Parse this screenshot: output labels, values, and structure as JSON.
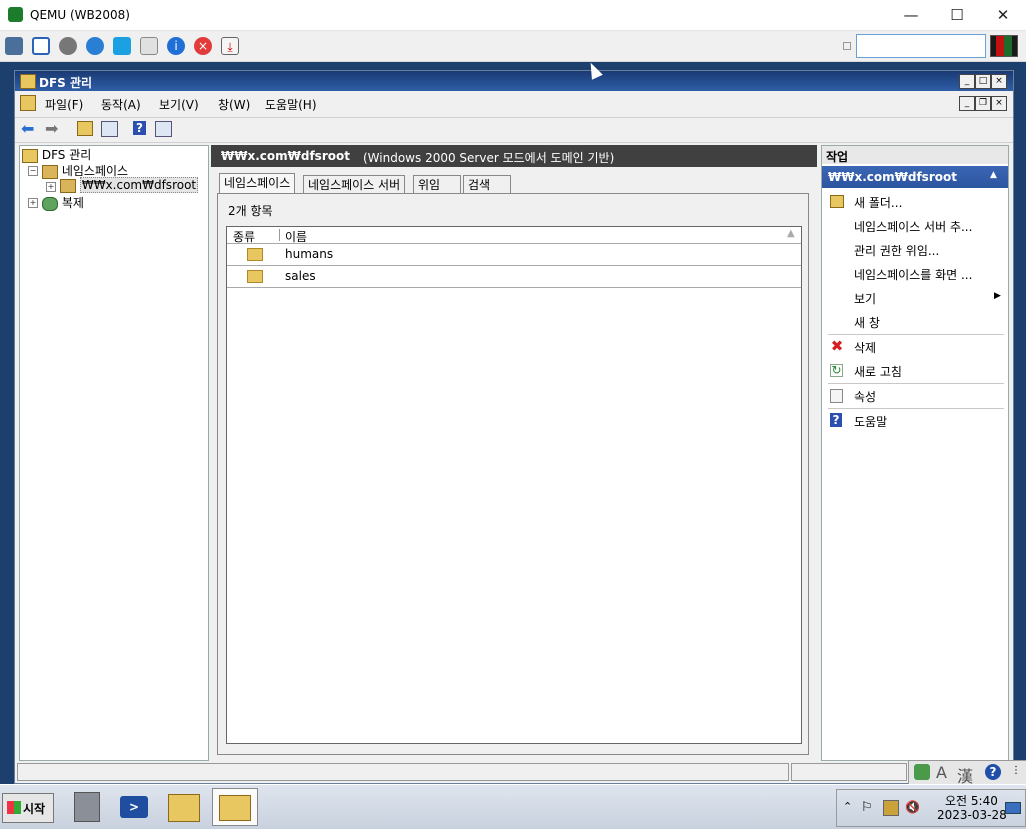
{
  "host": {
    "title": "QEMU (WB2008)",
    "min_icon": "—",
    "max_icon": "☐",
    "close_icon": "✕"
  },
  "mmc": {
    "title": "DFS 관리",
    "menu": [
      "파일(F)",
      "동작(A)",
      "보기(V)",
      "창(W)",
      "도움말(H)"
    ]
  },
  "tree": {
    "root": "DFS 관리",
    "namespaces": "네임스페이스",
    "selected": "₩₩x.com₩dfsroot",
    "replication": "복제"
  },
  "center": {
    "path": "₩₩x.com₩dfsroot",
    "description": "(Windows 2000 Server 모드에서 도메인 기반)",
    "tabs": [
      "네임스페이스",
      "네임스페이스 서버",
      "위임",
      "검색"
    ],
    "count": "2개 항목",
    "columns": [
      "종류",
      "이름"
    ],
    "rows": [
      {
        "name": "humans"
      },
      {
        "name": "sales"
      }
    ]
  },
  "actions": {
    "header": "작업",
    "subheader": "₩₩x.com₩dfsroot",
    "items": [
      "새 폴더...",
      "네임스페이스 서버 추...",
      "관리 권한 위임...",
      "네임스페이스를 화면 ...",
      "보기",
      "새 창",
      "삭제",
      "새로 고침",
      "속성",
      "도움말"
    ]
  },
  "taskbar": {
    "start": "시작",
    "time": "오전 5:40",
    "date": "2023-03-28"
  },
  "ime": {
    "label1": "A",
    "label2": "漢"
  },
  "colors": {
    "accent": "#2c55a0",
    "header_dark": "#404040",
    "delete_red": "#d42020"
  }
}
